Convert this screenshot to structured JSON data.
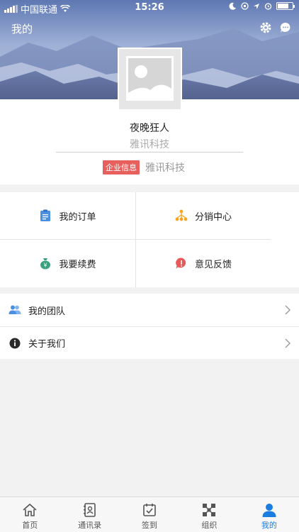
{
  "statusbar": {
    "carrier": "中国联通",
    "time": "15:26"
  },
  "header": {
    "title": "我的"
  },
  "profile": {
    "nickname": "夜晚狂人",
    "company": "雅讯科技",
    "enterprise_badge": "企业信息",
    "enterprise_name": "雅讯科技"
  },
  "grid": [
    {
      "label": "我的订单",
      "icon": "order-icon",
      "color": "#4a90e2"
    },
    {
      "label": "分销中心",
      "icon": "distribution-icon",
      "color": "#f5a623"
    },
    {
      "label": "我要续费",
      "icon": "renew-icon",
      "color": "#3aa17e"
    },
    {
      "label": "意见反馈",
      "icon": "feedback-icon",
      "color": "#e85a5a"
    }
  ],
  "list": [
    {
      "label": "我的团队",
      "icon": "team-icon"
    },
    {
      "label": "关于我们",
      "icon": "info-icon"
    }
  ],
  "tabbar": [
    {
      "label": "首页",
      "icon": "home-icon",
      "active": false
    },
    {
      "label": "通讯录",
      "icon": "contacts-icon",
      "active": false
    },
    {
      "label": "签到",
      "icon": "checkin-icon",
      "active": false
    },
    {
      "label": "组织",
      "icon": "org-icon",
      "active": false
    },
    {
      "label": "我的",
      "icon": "profile-icon",
      "active": true
    }
  ],
  "colors": {
    "accent": "#1a7de0",
    "badge": "#e8605e"
  }
}
